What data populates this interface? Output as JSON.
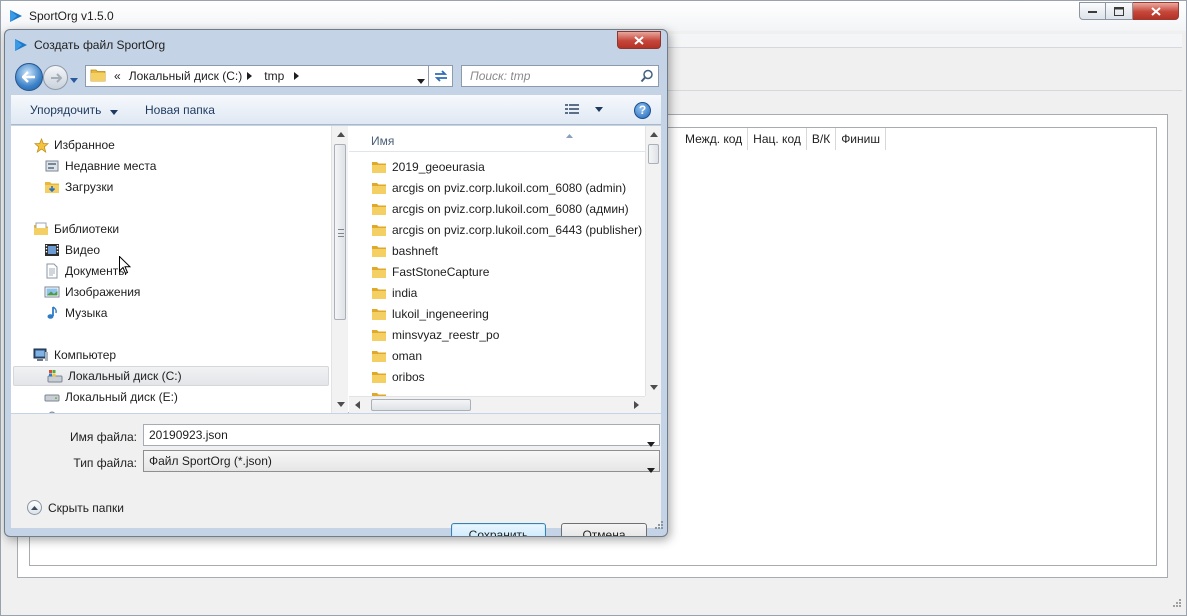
{
  "main_window": {
    "title": "SportOrg v1.5.0",
    "columns": [
      "Межд. код",
      "Нац. код",
      "В/К",
      "Финиш"
    ]
  },
  "dialog": {
    "title": "Создать файл SportOrg",
    "breadcrumb": {
      "overflow": "«",
      "segments": [
        "Локальный диск (C:)",
        "tmp"
      ]
    },
    "search": {
      "placeholder": "Поиск: tmp"
    },
    "commands": {
      "organize": "Упорядочить",
      "new_folder": "Новая папка",
      "help": "?"
    },
    "nav": {
      "favorites": {
        "label": "Избранное",
        "items": [
          "Недавние места",
          "Загрузки"
        ]
      },
      "libraries": {
        "label": "Библиотеки",
        "items": [
          "Видео",
          "Документы",
          "Изображения",
          "Музыка"
        ]
      },
      "computer": {
        "label": "Компьютер",
        "items": [
          "Локальный диск (C:)",
          "Локальный диск (E:)"
        ]
      },
      "selected": "Локальный диск (C:)"
    },
    "files": {
      "column_name": "Имя",
      "items": [
        "2019_geoeurasia",
        "arcgis on pviz.corp.lukoil.com_6080 (admin)",
        "arcgis on pviz.corp.lukoil.com_6080 (админ)",
        "arcgis on pviz.corp.lukoil.com_6443 (publisher)",
        "bashneft",
        "FastStoneCapture",
        "india",
        "lukoil_ingeneering",
        "minsvyaz_reestr_po",
        "oman",
        "oribos"
      ]
    },
    "form": {
      "filename_label": "Имя файла:",
      "filename_value": "20190923.json",
      "filetype_label": "Тип файла:",
      "filetype_value": "Файл SportOrg (*.json)"
    },
    "hide_folders": "Скрыть папки",
    "save_button": "Сохранить",
    "cancel_button": "Отмена"
  },
  "colors": {
    "dialog_frame": "#c4d3e5",
    "primary_button": "#bee6fd",
    "close_button": "#c7463a",
    "folder": "#e8b83a"
  }
}
